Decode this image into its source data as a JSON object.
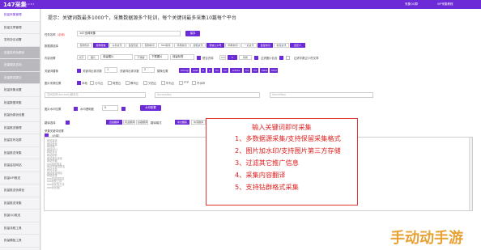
{
  "app": {
    "name": "147采集",
    "version": "V1.2.8.1",
    "top_links": [
      "采集QQ群",
      "VIP采集教程"
    ]
  },
  "sidebar": [
    "批量采集管理",
    "批量文章管理",
    "发布协议设置",
    "批量发布伪原创",
    "批量域名自动",
    "批量推送提交",
    "批量采集设置",
    "批量数据采集",
    "批量伪原创设置",
    "批量推送管理",
    "批量发布站群",
    "批量推送采集",
    "批量监控网站",
    "批量API推送",
    "批量推送伪原创",
    "批量推送采集",
    "批量QQ推送",
    "批量流程工具",
    "批量模板工具",
    "批量采集全网"
  ],
  "notice": "提示：关键词数最多1000个，采集数据源多个轮训，每个关键词最多采集10篇每个平台",
  "task": {
    "label": "任务名称",
    "req": "（必填）",
    "value": "147全网采集",
    "save": "保存"
  },
  "source": {
    "label": "数据源选择",
    "items": [
      "搜狗知乎",
      "搜狗微信",
      "头条资讯",
      "百度知道",
      "搜狗新闻",
      "360新闻",
      "凤凰新闻",
      "搜狐资讯",
      "微信公众号",
      "网易新闻",
      "一点资讯",
      "百度新闻",
      "新浪资讯",
      "自定义"
    ]
  },
  "images": {
    "label": "内容设置",
    "items": [
      "文字",
      "图片",
      "保留图片",
      "不保留",
      "下载图片",
      "保留标签",
      "替换"
    ],
    "opt1": "是否去除",
    "opt2": "过滤图片包含",
    "opt3": "过滤字数过少的文章"
  },
  "replace": {
    "label": "关键词替换",
    "labels": [
      "关键词替换",
      "关键词出现次数",
      "替换位置"
    ],
    "v1": "1",
    "v2": "2",
    "tags": [
      "strong",
      "span",
      "b",
      "p",
      "h1",
      "h2",
      "article",
      "h3",
      "h4",
      "table",
      "html"
    ]
  },
  "location": {
    "label": "图片来源位置",
    "items": [
      "本地",
      "七牛云",
      "阿里云",
      "腾讯云",
      "又拍云",
      "华为云",
      "FTP",
      "不水印"
    ]
  },
  "bucket": {
    "ph1": "空间名称(bucket)/服务名",
    "ph2": "AccessKey",
    "ph3": "SecretKey"
  },
  "watermark": {
    "label": "图片水印位置",
    "opt": "水印透明度",
    "v": "0",
    "btn": "水印配置"
  },
  "translate": {
    "label": "翻译选择",
    "items": [
      "百度翻译",
      "有道翻译",
      "谷歌翻译"
    ],
    "mode_label": "翻译模式",
    "modes": [
      "中文翻英",
      "中英翻译",
      "多语翻译"
    ],
    "btn": "接口配置"
  },
  "keywords": {
    "label": "采集关键词设置",
    "req": "（必填）",
    "list": [
      "网站建设",
      "网站优化",
      "网站推广",
      "网站SEO",
      "网站设计",
      "网站制作",
      "网站排名优化",
      "网站外链",
      "seo优化排名",
      "网站关键词排名",
      "网站流量",
      "网站收录排名",
      "网站收录",
      "seo关键词排名",
      "seo优化工具",
      "seo优化的方法",
      "seo优化推广"
    ]
  },
  "overlay": {
    "title": "输入关键词即可采集",
    "lines": [
      "1、多数据源采集/支持保留采集格式",
      "2、图片加水印/支持图片第三方存储",
      "3、过滤其它推广信息",
      "4、采集内容翻译",
      "5、支持钻群格式采集"
    ]
  },
  "watermark_text": "手动动手游"
}
